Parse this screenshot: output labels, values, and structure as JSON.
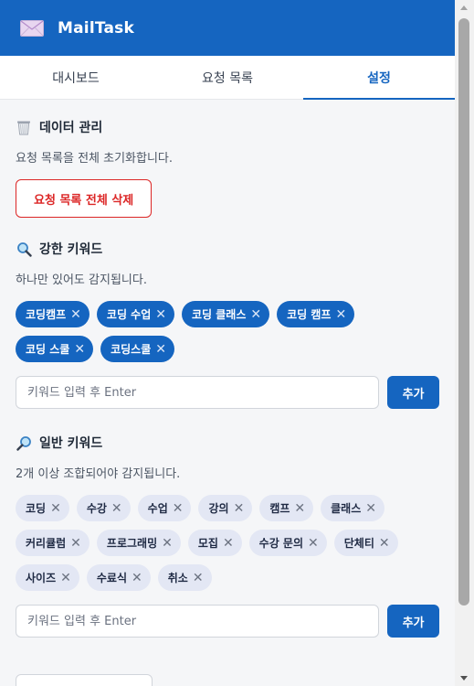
{
  "app": {
    "title": "MailTask"
  },
  "tabs": [
    {
      "label": "대시보드",
      "active": false
    },
    {
      "label": "요청 목록",
      "active": false
    },
    {
      "label": "설정",
      "active": true
    }
  ],
  "data_management": {
    "title": "데이터 관리",
    "icon": "wastebasket-icon",
    "description": "요청 목록을 전체 초기화합니다.",
    "button_label": "요청 목록 전체 삭제"
  },
  "strong_keywords": {
    "title": "강한 키워드",
    "icon": "magnifier-left-icon",
    "description": "하나만 있어도 감지됩니다.",
    "items": [
      "코딩캠프",
      "코딩 수업",
      "코딩 클래스",
      "코딩 캠프",
      "코딩 스쿨",
      "코딩스쿨"
    ],
    "input_placeholder": "키워드 입력 후 Enter",
    "add_label": "추가"
  },
  "normal_keywords": {
    "title": "일반 키워드",
    "icon": "magnifier-right-icon",
    "description": "2개 이상 조합되어야 감지됩니다.",
    "items": [
      "코딩",
      "수강",
      "수업",
      "강의",
      "캠프",
      "클래스",
      "커리큘럼",
      "프로그래밍",
      "모집",
      "수강 문의",
      "단체티",
      "사이즈",
      "수료식",
      "취소"
    ],
    "input_placeholder": "키워드 입력 후 Enter",
    "add_label": "추가"
  },
  "remove_symbol": "✕",
  "colors": {
    "primary": "#1565c0",
    "danger": "#dc2626",
    "chip_normal_bg": "#e3e7f4",
    "content_bg": "#f5f6f8"
  }
}
